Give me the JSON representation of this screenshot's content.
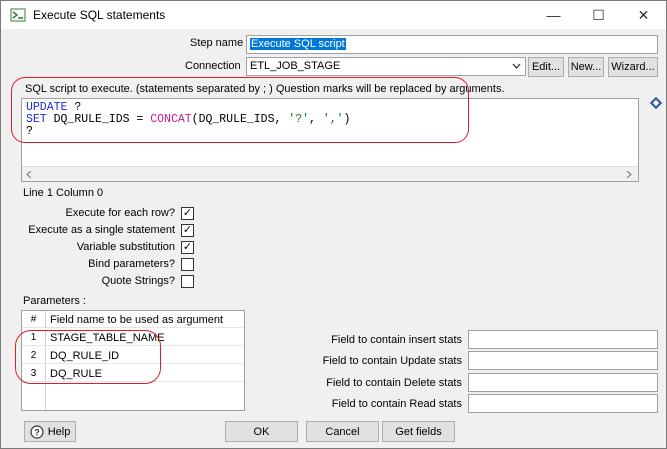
{
  "window": {
    "title": "Execute SQL statements",
    "minimize_glyph": "—",
    "maximize_glyph": "☐",
    "close_glyph": "✕"
  },
  "step": {
    "label": "Step name",
    "value": "Execute SQL script"
  },
  "connection": {
    "label": "Connection",
    "value": "ETL_JOB_STAGE",
    "edit_label": "Edit...",
    "new_label": "New...",
    "wizard_label": "Wizard..."
  },
  "sql": {
    "heading": "SQL script to execute. (statements separated by ; ) Question marks will be replaced by arguments.",
    "line1_kw": "UPDATE",
    "line1_rest": " ?",
    "line2_kw": "SET",
    "line2_a": " DQ_RULE_IDS = ",
    "line2_fn": "CONCAT",
    "line2_b": "(DQ_RULE_IDS, ",
    "line2_s1": "'?'",
    "line2_c": ", ",
    "line2_s2": "','",
    "line2_d": ")",
    "line3": "?"
  },
  "position": "Line 1 Column 0",
  "options": [
    {
      "label": "Execute for each row?",
      "checked": true
    },
    {
      "label": "Execute as a single statement",
      "checked": true
    },
    {
      "label": "Variable substitution",
      "checked": true
    },
    {
      "label": "Bind parameters?",
      "checked": false
    },
    {
      "label": "Quote Strings?",
      "checked": false
    }
  ],
  "parameters": {
    "label": "Parameters :",
    "col_num": "#",
    "col_field": "Field name to be used as argument",
    "rows": [
      {
        "num": "1",
        "field": "STAGE_TABLE_NAME"
      },
      {
        "num": "2",
        "field": "DQ_RULE_ID"
      },
      {
        "num": "3",
        "field": "DQ_RULE"
      }
    ]
  },
  "stats": [
    {
      "label": "Field to contain insert stats",
      "value": ""
    },
    {
      "label": "Field to contain Update stats",
      "value": ""
    },
    {
      "label": "Field to contain Delete stats",
      "value": ""
    },
    {
      "label": "Field to contain Read stats",
      "value": ""
    }
  ],
  "buttons": {
    "help": "Help",
    "ok": "OK",
    "cancel": "Cancel",
    "get_fields": "Get fields"
  },
  "check_mark": "✓",
  "colors": {
    "highlight": "#0078d7",
    "annotation": "#d8202a"
  }
}
